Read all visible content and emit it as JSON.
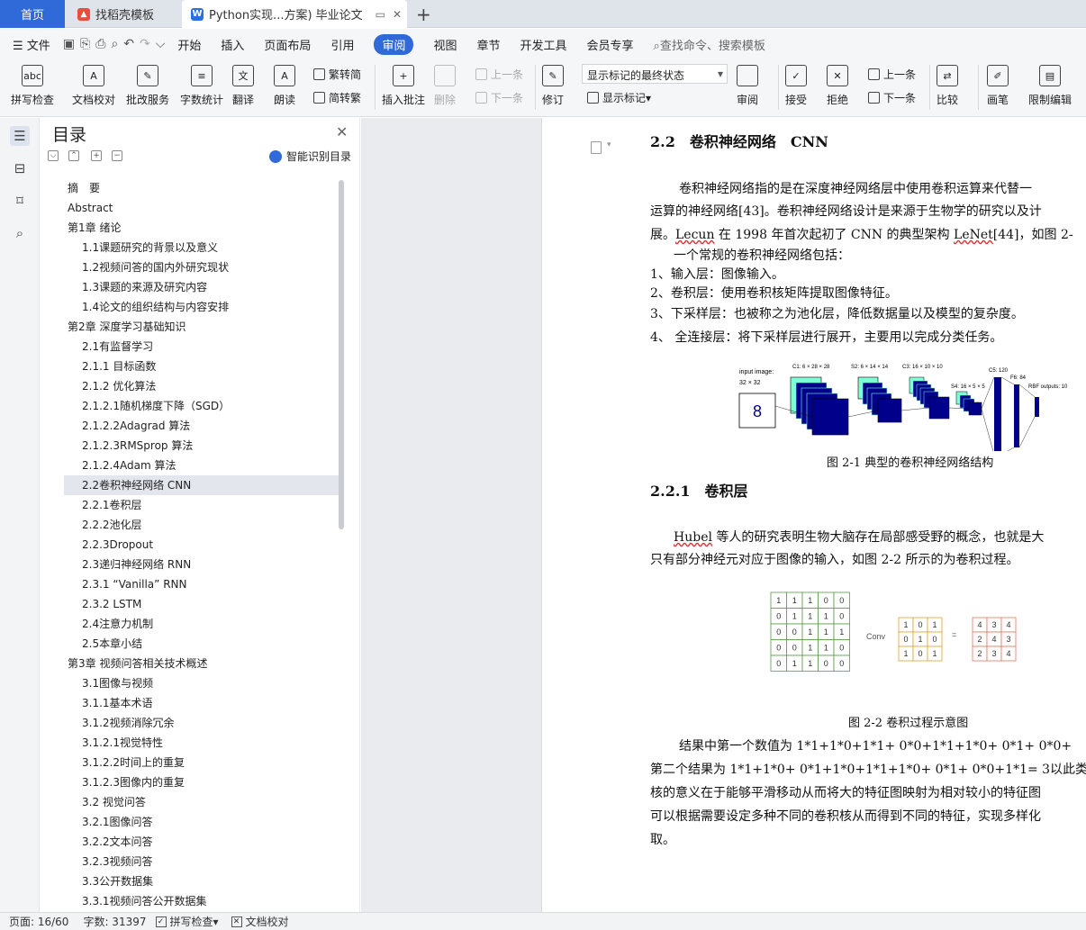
{
  "tabs": {
    "home": "首页",
    "template": "找稻壳模板",
    "document": "Python实现...方案) 毕业论文",
    "add": "+"
  },
  "menu": {
    "file": "文件",
    "items": [
      "开始",
      "插入",
      "页面布局",
      "引用",
      "审阅",
      "视图",
      "章节",
      "开发工具",
      "会员专享"
    ],
    "active_index": 4,
    "search": "查找命令、搜索模板"
  },
  "ribbon": {
    "spell": "拼写检查",
    "proof": "文档校对",
    "annotate_service": "批改服务",
    "word_count": "字数统计",
    "translate": "翻译",
    "read_aloud": "朗读",
    "trad": "繁转简",
    "simp": "简转繁",
    "insert_comment": "插入批注",
    "delete": "删除",
    "prev_comment": "上一条",
    "next_comment": "下一条",
    "revise": "修订",
    "markup_select": "显示标记的最终状态",
    "show_markup": "显示标记",
    "review": "审阅",
    "accept": "接受",
    "reject": "拒绝",
    "prev_change": "上一条",
    "next_change": "下一条",
    "compare": "比较",
    "draw": "画笔",
    "restrict": "限制编辑"
  },
  "toc": {
    "title": "目录",
    "smart_toc": "智能识别目录",
    "items": [
      {
        "label": "摘　要",
        "level": 0
      },
      {
        "label": "Abstract",
        "level": 0
      },
      {
        "label": "第1章 绪论",
        "level": 0,
        "arrow": "⌵"
      },
      {
        "label": "1.1课题研究的背景以及意义",
        "level": 1
      },
      {
        "label": "1.2视频问答的国内外研究现状",
        "level": 1
      },
      {
        "label": "1.3课题的来源及研究内容",
        "level": 1
      },
      {
        "label": "1.4论文的组织结构与内容安排",
        "level": 1
      },
      {
        "label": "第2章 深度学习基础知识",
        "level": 0,
        "arrow": "›"
      },
      {
        "label": "2.1有监督学习",
        "level": 1
      },
      {
        "label": "2.1.1 目标函数",
        "level": 1
      },
      {
        "label": "2.1.2 优化算法",
        "level": 1
      },
      {
        "label": "2.1.2.1随机梯度下降（SGD）",
        "level": 1
      },
      {
        "label": "2.1.2.2Adagrad 算法",
        "level": 1
      },
      {
        "label": "2.1.2.3RMSprop 算法",
        "level": 1
      },
      {
        "label": "2.1.2.4Adam 算法",
        "level": 1
      },
      {
        "label": "2.2卷积神经网络 CNN",
        "level": 1,
        "selected": true
      },
      {
        "label": "2.2.1卷积层",
        "level": 1
      },
      {
        "label": "2.2.2池化层",
        "level": 1
      },
      {
        "label": "2.2.3Dropout",
        "level": 1
      },
      {
        "label": "2.3递归神经网络 RNN",
        "level": 1
      },
      {
        "label": "2.3.1 “Vanilla” RNN",
        "level": 1
      },
      {
        "label": "2.3.2 LSTM",
        "level": 1
      },
      {
        "label": "2.4注意力机制",
        "level": 1
      },
      {
        "label": "2.5本章小结",
        "level": 1
      },
      {
        "label": "第3章 视频问答相关技术概述",
        "level": 0,
        "arrow": "›"
      },
      {
        "label": "3.1图像与视频",
        "level": 1
      },
      {
        "label": "3.1.1基本术语",
        "level": 1
      },
      {
        "label": "3.1.2视频消除冗余",
        "level": 1
      },
      {
        "label": "3.1.2.1视觉特性",
        "level": 1
      },
      {
        "label": "3.1.2.2时间上的重复",
        "level": 1
      },
      {
        "label": "3.1.2.3图像内的重复",
        "level": 1
      },
      {
        "label": "3.2 视觉问答",
        "level": 1
      },
      {
        "label": "3.2.1图像问答",
        "level": 1
      },
      {
        "label": "3.2.2文本问答",
        "level": 1
      },
      {
        "label": "3.2.3视频问答",
        "level": 1
      },
      {
        "label": "3.3公开数据集",
        "level": 1
      },
      {
        "label": "3.3.1视频问答公开数据集",
        "level": 1
      }
    ]
  },
  "doc": {
    "h_22": "2.2　卷积神经网络　CNN",
    "p1_l1": "卷积神经网络指的是在深度神经网络层中使用卷积运算来代替一",
    "p1_l2": "运算的神经网络[43]。卷积神经网络设计是来源于生物学的研究以及计",
    "p1_l3a": "展。",
    "p1_l3b": "Lecun",
    "p1_l3c": " 在 1998 年首次起初了 CNN 的典型架构 ",
    "p1_l3d": "LeNet",
    "p1_l3e": "[44]，如图 2-",
    "p2": "一个常规的卷积神经网络包括：",
    "li1": "1、输入层：图像输入。",
    "li2": "2、卷积层：使用卷积核矩阵提取图像特征。",
    "li3": "3、下采样层：也被称之为池化层，降低数据量以及模型的复杂度。",
    "li4": "4、 全连接层：将下采样层进行展开，主要用以完成分类任务。",
    "fig1_caption": "图 2-1  典型的卷积神经网络结构",
    "h_221": "2.2.1　卷积层",
    "p3_l1a": "Hubel",
    "p3_l1b": " 等人的研究表明生物大脑存在局部感受野的概念，也就是大",
    "p3_l2": "只有部分神经元对应于图像的输入，如图 2-2 所示的为卷积过程。",
    "fig2_caption": "图 2-2  卷积过程示意图",
    "p4_l1": "结果中第一个数值为 1*1+1*0+1*1+ 0*0+1*1+1*0+ 0*1+ 0*0+",
    "p4_l2": "第二个结果为 1*1+1*0+ 0*1+1*0+1*1+1*0+ 0*1+ 0*0+1*1= 3以此类",
    "p4_l3": "核的意义在于能够平滑移动从而将大的特征图映射为相对较小的特征图",
    "p4_l4": "可以根据需要设定多种不同的卷积核从而得到不同的特征，实现多样化",
    "p4_l5": "取。"
  },
  "lenet": {
    "input_label": "input image:",
    "input_size": "32 × 32",
    "c1": "C1: 6 × 28 × 28",
    "s2": "S2: 6 × 14 × 14",
    "c3": "C3: 16 × 10 × 10",
    "s4": "S4: 16 × 5 × 5",
    "c5": "C5: 120",
    "f6": "F6: 84",
    "out": "RBF outputs: 10"
  },
  "conv": {
    "input": [
      [
        1,
        1,
        1,
        0,
        0
      ],
      [
        0,
        1,
        1,
        1,
        0
      ],
      [
        0,
        0,
        1,
        1,
        1
      ],
      [
        0,
        0,
        1,
        1,
        0
      ],
      [
        0,
        1,
        1,
        0,
        0
      ]
    ],
    "label": "Conv",
    "kernel": [
      [
        1,
        0,
        1
      ],
      [
        0,
        1,
        0
      ],
      [
        1,
        0,
        1
      ]
    ],
    "eq": "=",
    "output": [
      [
        4,
        3,
        4
      ],
      [
        2,
        4,
        3
      ],
      [
        2,
        3,
        4
      ]
    ]
  },
  "status": {
    "page": "页面: 16/60",
    "words": "字数: 31397",
    "spell": "拼写检查",
    "proof": "文档校对"
  }
}
